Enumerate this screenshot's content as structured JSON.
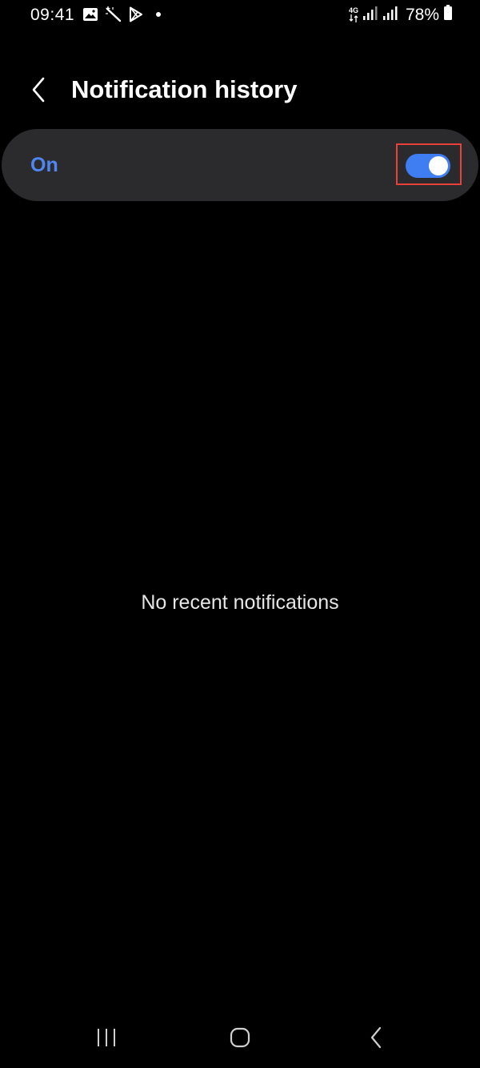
{
  "status_bar": {
    "time": "09:41",
    "network_type": "4G",
    "battery_percent": "78%",
    "icons_left": [
      "gallery-icon",
      "magic-wand-icon",
      "play-store-icon",
      "notification-dot"
    ],
    "icons_right": [
      "network-4g-icon",
      "signal-icon",
      "signal-icon",
      "battery-icon"
    ]
  },
  "header": {
    "title": "Notification history",
    "back_icon": "chevron-left-icon"
  },
  "master_switch": {
    "label": "On",
    "checked": true
  },
  "empty_state": {
    "text": "No recent notifications"
  },
  "nav_bar": {
    "items": [
      "recents-icon",
      "home-icon",
      "back-icon"
    ]
  },
  "colors": {
    "background": "#000000",
    "card": "#2b2b2e",
    "accent": "#3f7ef2",
    "accent_text": "#4f86f0",
    "highlight": "#e8413a"
  }
}
